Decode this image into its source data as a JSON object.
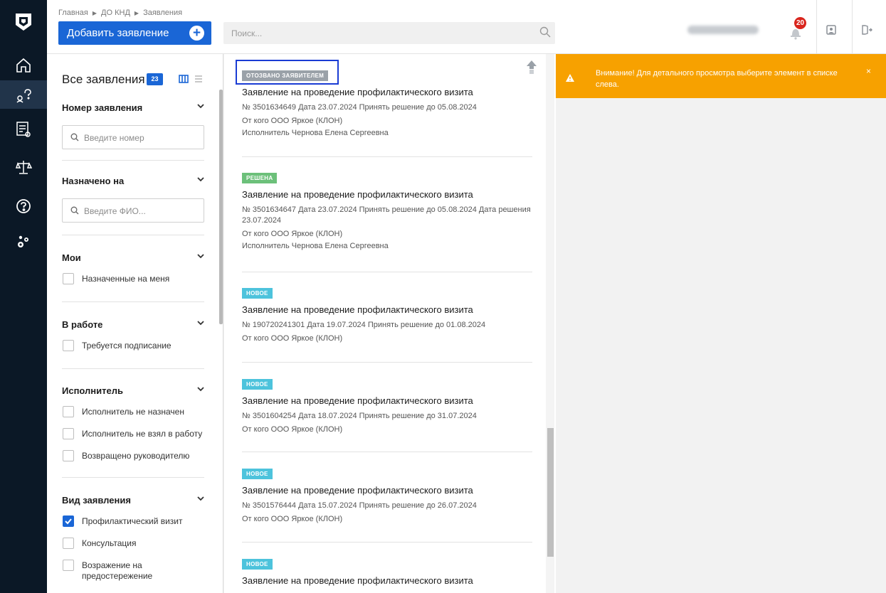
{
  "breadcrumb": [
    "Главная",
    "ДО КНД",
    "Заявления"
  ],
  "header": {
    "add_button": "Добавить заявление",
    "search_placeholder": "Поиск...",
    "notifications_count": "20"
  },
  "filters": {
    "title": "Все заявления",
    "count": "23",
    "sections": {
      "number": {
        "label": "Номер заявления",
        "placeholder": "Введите номер"
      },
      "assigned": {
        "label": "Назначено на",
        "placeholder": "Введите ФИО..."
      },
      "mine": {
        "label": "Мои",
        "options": [
          "Назначенные на меня"
        ]
      },
      "in_work": {
        "label": "В работе",
        "options": [
          "Требуется подписание"
        ]
      },
      "executor": {
        "label": "Исполнитель",
        "options": [
          "Исполнитель не назначен",
          "Исполнитель не взял в работу",
          "Возвращено руководителю"
        ]
      },
      "kind": {
        "label": "Вид заявления",
        "options": [
          "Профилактический визит",
          "Консультация",
          "Возражение на предостережение"
        ],
        "checked": [
          true,
          false,
          false
        ]
      }
    }
  },
  "cards": [
    {
      "status": "ОТОЗВАНО ЗАЯВИТЕЛЕМ",
      "status_color": "#9aa1a8",
      "title": "Заявление на проведение профилактического визита",
      "meta": "№ 3501634649  Дата 23.07.2024  Принять решение до 05.08.2024",
      "from": "От кого ООО Яркое (КЛОН)",
      "executor": "Исполнитель Чернова Елена Сергеевна"
    },
    {
      "status": "РЕШЕНА",
      "status_color": "#6cc07a",
      "title": "Заявление на проведение профилактического визита",
      "meta": "№ 3501634647  Дата 23.07.2024  Принять решение до 05.08.2024  Дата решения 23.07.2024",
      "from": "От кого ООО Яркое (КЛОН)",
      "executor": "Исполнитель Чернова Елена Сергеевна"
    },
    {
      "status": "НОВОЕ",
      "status_color": "#4dc3dc",
      "title": "Заявление на проведение профилактического визита",
      "meta": "№ 190720241301  Дата 19.07.2024  Принять решение до 01.08.2024",
      "from": "От кого ООО Яркое (КЛОН)"
    },
    {
      "status": "НОВОЕ",
      "status_color": "#4dc3dc",
      "title": "Заявление на проведение профилактического визита",
      "meta": "№ 3501604254  Дата 18.07.2024  Принять решение до 31.07.2024",
      "from": "От кого ООО Яркое (КЛОН)"
    },
    {
      "status": "НОВОЕ",
      "status_color": "#4dc3dc",
      "title": "Заявление на проведение профилактического визита",
      "meta": "№ 3501576444  Дата 15.07.2024  Принять решение до 26.07.2024",
      "from": "От кого ООО Яркое (КЛОН)"
    },
    {
      "status": "НОВОЕ",
      "status_color": "#4dc3dc",
      "title": "Заявление на проведение профилактического визита"
    }
  ],
  "warning": {
    "text": "Внимание! Для детального просмотра выберите элемент в списке слева.",
    "close": "×"
  },
  "colors": {
    "accent": "#1a66d6",
    "rail": "#0b1826",
    "warning": "#f7a100",
    "badge": "#d9251d"
  }
}
